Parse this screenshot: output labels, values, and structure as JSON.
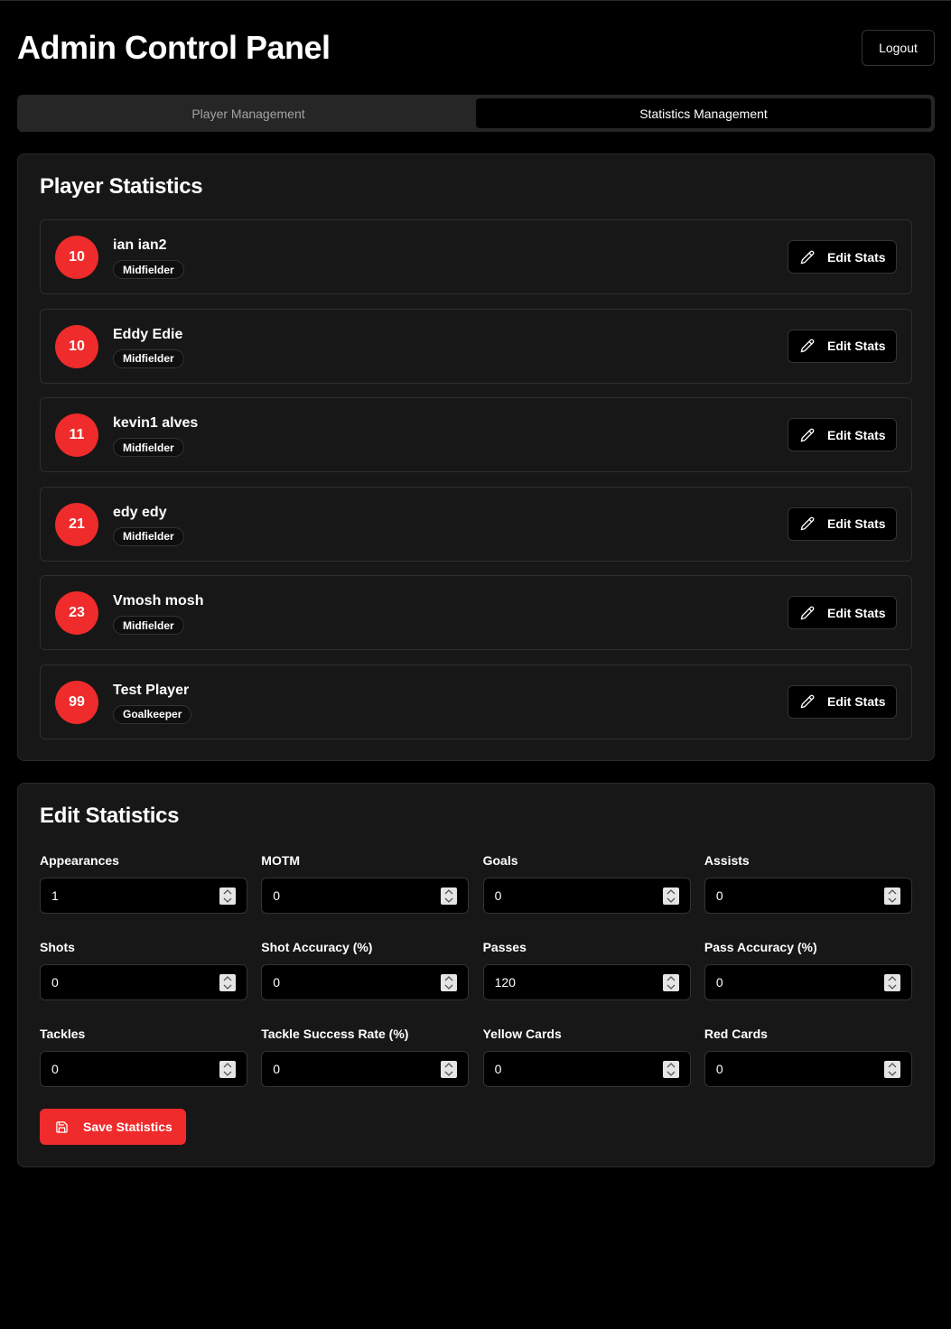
{
  "header": {
    "title": "Admin Control Panel",
    "logout_label": "Logout"
  },
  "tabs": [
    {
      "label": "Player Management",
      "active": false
    },
    {
      "label": "Statistics Management",
      "active": true
    }
  ],
  "player_statistics": {
    "title": "Player Statistics",
    "edit_label": "Edit Stats",
    "players": [
      {
        "number": "10",
        "name": "ian ian2",
        "position": "Midfielder"
      },
      {
        "number": "10",
        "name": "Eddy Edie",
        "position": "Midfielder"
      },
      {
        "number": "11",
        "name": "kevin1 alves",
        "position": "Midfielder"
      },
      {
        "number": "21",
        "name": "edy edy",
        "position": "Midfielder"
      },
      {
        "number": "23",
        "name": "Vmosh mosh",
        "position": "Midfielder"
      },
      {
        "number": "99",
        "name": "Test Player",
        "position": "Goalkeeper"
      }
    ]
  },
  "edit_statistics": {
    "title": "Edit Statistics",
    "fields": [
      {
        "label": "Appearances",
        "value": "1"
      },
      {
        "label": "MOTM",
        "value": "0"
      },
      {
        "label": "Goals",
        "value": "0"
      },
      {
        "label": "Assists",
        "value": "0"
      },
      {
        "label": "Shots",
        "value": "0"
      },
      {
        "label": "Shot Accuracy (%)",
        "value": "0"
      },
      {
        "label": "Passes",
        "value": "120"
      },
      {
        "label": "Pass Accuracy (%)",
        "value": "0"
      },
      {
        "label": "Tackles",
        "value": "0"
      },
      {
        "label": "Tackle Success Rate (%)",
        "value": "0"
      },
      {
        "label": "Yellow Cards",
        "value": "0"
      },
      {
        "label": "Red Cards",
        "value": "0"
      }
    ],
    "save_label": "Save Statistics"
  },
  "colors": {
    "accent": "#ef2b2b",
    "background": "#000000",
    "card": "#171717",
    "border": "#2e2e2e"
  },
  "icons": {
    "edit": "pencil-icon",
    "save": "floppy-disk-icon",
    "spinner": "spinner-arrows-icon"
  }
}
